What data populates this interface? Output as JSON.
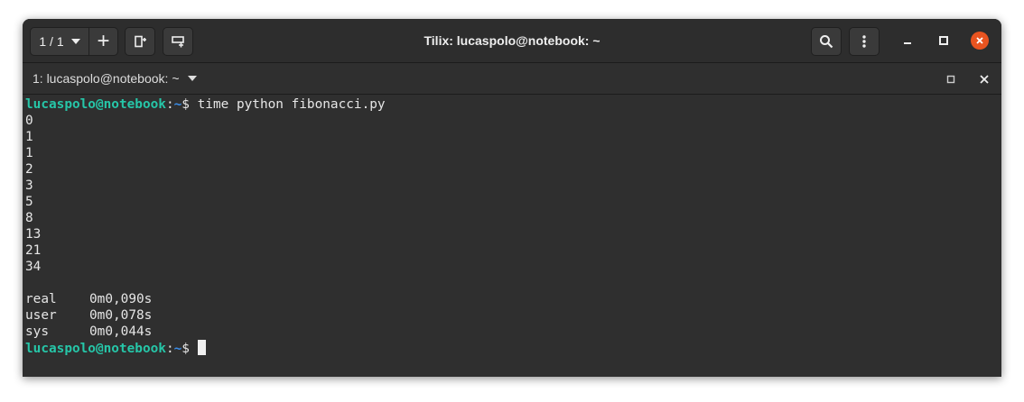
{
  "window": {
    "title": "Tilix: lucaspolo@notebook: ~",
    "session_selector": "1 / 1",
    "add_button": "+"
  },
  "tab": {
    "title": "1: lucaspolo@notebook: ~"
  },
  "terminal": {
    "prompt_user": "lucaspolo@notebook",
    "prompt_sep": ":",
    "prompt_dir": "~",
    "prompt_symbol": "$",
    "command": " time python fibonacci.py",
    "output": [
      "0",
      "1",
      "1",
      "2",
      "3",
      "5",
      "8",
      "13",
      "21",
      "34"
    ],
    "timing": [
      {
        "label": "real",
        "value": "0m0,090s"
      },
      {
        "label": "user",
        "value": "0m0,078s"
      },
      {
        "label": "sys",
        "value": "0m0,044s"
      }
    ]
  },
  "icons": {
    "session_dropdown": "chevron-down-icon",
    "add_terminal": "plus-icon",
    "split_right": "split-horizontal-icon",
    "split_down": "split-vertical-icon",
    "search": "search-icon",
    "menu": "vertical-ellipsis-icon",
    "minimize": "minimize-icon",
    "maximize": "maximize-icon",
    "close": "close-icon",
    "tab_dropdown": "chevron-down-icon",
    "tab_maximize": "maximize-icon",
    "tab_close": "close-icon"
  },
  "colors": {
    "background": "#2f2f2f",
    "text": "#e6e6e6",
    "prompt_user": "#26c6a8",
    "prompt_dir": "#3b8eea",
    "close_button": "#e95420"
  }
}
